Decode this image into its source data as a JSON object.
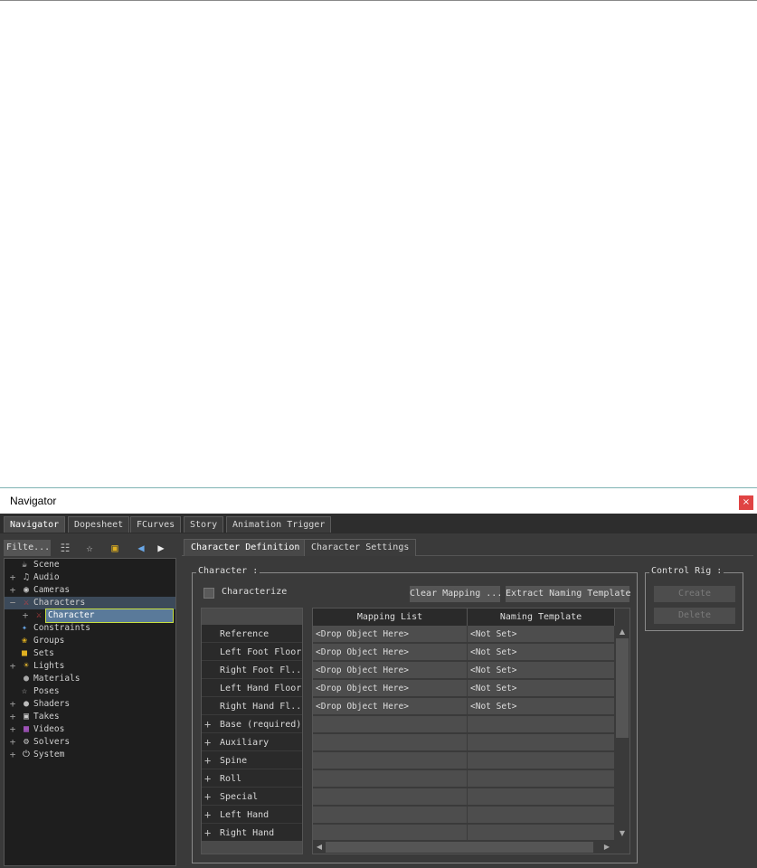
{
  "window": {
    "title": "Navigator",
    "close_glyph": "×"
  },
  "main_tabs": [
    {
      "label": "Navigator",
      "active": true
    },
    {
      "label": "Dopesheet",
      "active": false
    },
    {
      "label": "FCurves",
      "active": false
    },
    {
      "label": "Story",
      "active": false
    },
    {
      "label": "Animation Trigger",
      "active": false
    }
  ],
  "left_toolbar": {
    "filter_label": "Filte...",
    "icons": [
      "list-view-icon",
      "star-icon",
      "lock-icon",
      "back-arrow-icon",
      "forward-arrow-icon"
    ]
  },
  "tree": [
    {
      "label": "Scene",
      "expander": "",
      "icon": "teapot-icon",
      "glyph": "☕"
    },
    {
      "label": "Audio",
      "expander": "+",
      "icon": "speaker-icon",
      "glyph": "♫"
    },
    {
      "label": "Cameras",
      "expander": "+",
      "icon": "camera-icon",
      "glyph": "◉"
    },
    {
      "label": "Characters",
      "expander": "−",
      "icon": "character-icon",
      "glyph": "⚔"
    },
    {
      "label": "Character",
      "expander": "+",
      "icon": "character-icon",
      "glyph": "⚔"
    },
    {
      "label": "Constraints",
      "expander": "",
      "icon": "constraint-icon",
      "glyph": "✦"
    },
    {
      "label": "Groups",
      "expander": "",
      "icon": "groups-icon",
      "glyph": "❀"
    },
    {
      "label": "Sets",
      "expander": "",
      "icon": "folder-icon",
      "glyph": "■"
    },
    {
      "label": "Lights",
      "expander": "+",
      "icon": "light-icon",
      "glyph": "☀"
    },
    {
      "label": "Materials",
      "expander": "",
      "icon": "material-icon",
      "glyph": "●"
    },
    {
      "label": "Poses",
      "expander": "",
      "icon": "pose-icon",
      "glyph": "☆"
    },
    {
      "label": "Shaders",
      "expander": "+",
      "icon": "shader-icon",
      "glyph": "●"
    },
    {
      "label": "Takes",
      "expander": "+",
      "icon": "take-icon",
      "glyph": "▣"
    },
    {
      "label": "Videos",
      "expander": "+",
      "icon": "video-icon",
      "glyph": "▦"
    },
    {
      "label": "Solvers",
      "expander": "+",
      "icon": "solver-icon",
      "glyph": "⚙"
    },
    {
      "label": "System",
      "expander": "+",
      "icon": "system-icon",
      "glyph": "⏻"
    }
  ],
  "sub_tabs": [
    {
      "label": "Character Definition",
      "active": true
    },
    {
      "label": "Character Settings",
      "active": false
    }
  ],
  "character_group": {
    "label": "Character :",
    "characterize_label": "Characterize",
    "characterize_checked": false,
    "clear_mapping_label": "Clear Mapping ...",
    "extract_template_label": "Extract Naming Template"
  },
  "mapping_rows": [
    {
      "label": "Reference",
      "expandable": false
    },
    {
      "label": "Left Foot Floor",
      "expandable": false
    },
    {
      "label": "Right Foot Fl...",
      "expandable": false
    },
    {
      "label": "Left Hand Floor",
      "expandable": false
    },
    {
      "label": "Right Hand Fl...",
      "expandable": false
    },
    {
      "label": "Base (required)",
      "expandable": true
    },
    {
      "label": "Auxiliary",
      "expandable": true
    },
    {
      "label": "Spine",
      "expandable": true
    },
    {
      "label": "Roll",
      "expandable": true
    },
    {
      "label": "Special",
      "expandable": true
    },
    {
      "label": "Left Hand",
      "expandable": true
    },
    {
      "label": "Right Hand",
      "expandable": true
    }
  ],
  "grid": {
    "columns": [
      "Mapping List",
      "Naming Template"
    ],
    "rows": [
      [
        "<Drop Object Here>",
        "<Not Set>"
      ],
      [
        "<Drop Object Here>",
        "<Not Set>"
      ],
      [
        "<Drop Object Here>",
        "<Not Set>"
      ],
      [
        "<Drop Object Here>",
        "<Not Set>"
      ],
      [
        "<Drop Object Here>",
        "<Not Set>"
      ],
      [
        "",
        ""
      ],
      [
        "",
        ""
      ],
      [
        "",
        ""
      ],
      [
        "",
        ""
      ],
      [
        "",
        ""
      ],
      [
        "",
        ""
      ],
      [
        "",
        ""
      ]
    ]
  },
  "control_rig": {
    "label": "Control Rig :",
    "create_label": "Create",
    "delete_label": "Delete"
  },
  "colors": {
    "panel_bg": "#3a3a3a",
    "tree_bg": "#1e1e1e",
    "selection": "#5a7a9a",
    "selection_outline": "#c8e040",
    "close_button": "#e04343"
  }
}
